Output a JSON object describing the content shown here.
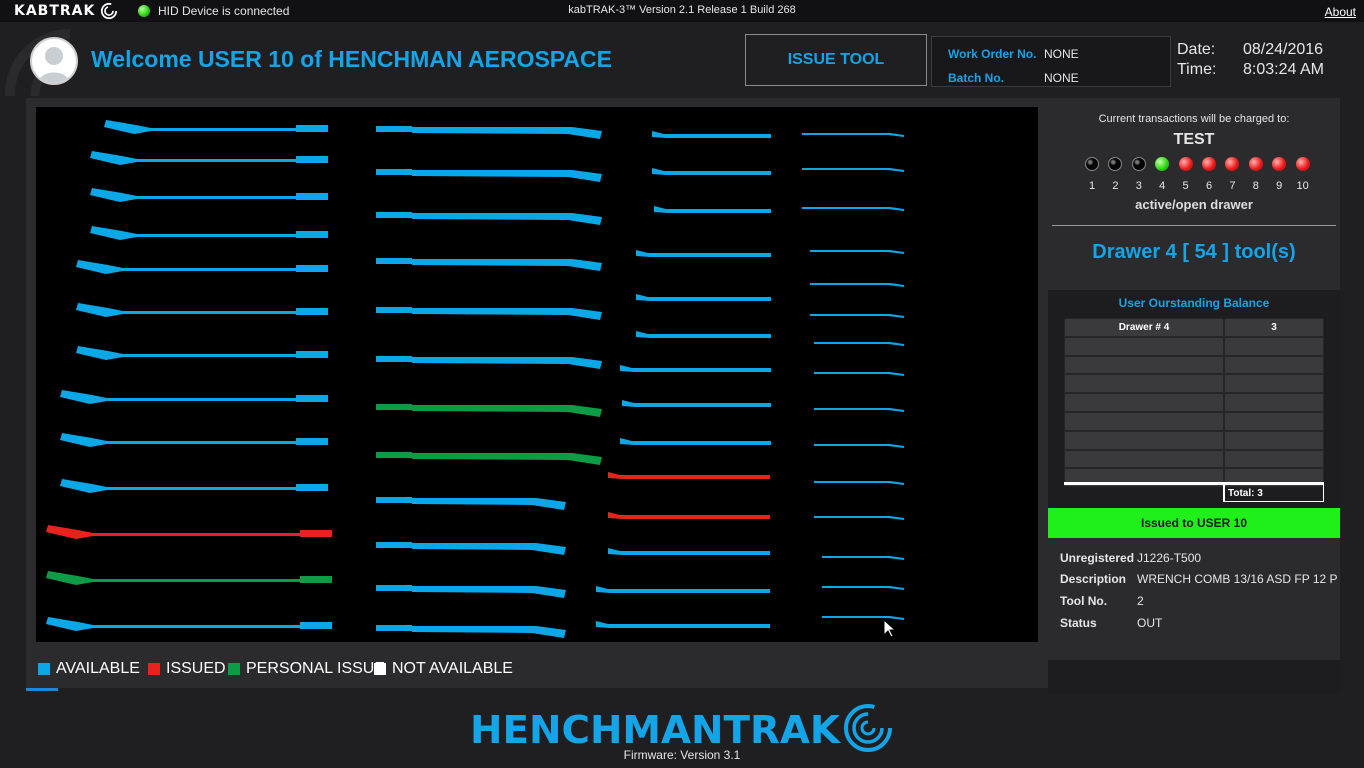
{
  "topbar": {
    "brand": "KABTRAK",
    "hid_status": "HID Device is connected",
    "app_version": "kabTRAK-3™ Version 2.1 Release 1 Build 268",
    "about": "About"
  },
  "header": {
    "welcome": "Welcome USER 10 of HENCHMAN AEROSPACE",
    "issue_button": "ISSUE TOOL",
    "work_order_label": "Work Order No.",
    "work_order_value": "NONE",
    "batch_label": "Batch No.",
    "batch_value": "NONE",
    "date_label": "Date:",
    "date_value": "08/24/2016",
    "time_label": "Time:",
    "time_value": "8:03:24 AM"
  },
  "colors": {
    "available": "#0ba7e6",
    "issued": "#e8231e",
    "personal_issue": "#0c9c45",
    "not_available": "#ffffff",
    "accent": "#14a4e8"
  },
  "legend": [
    {
      "label": "AVAILABLE",
      "color": "#0ba7e6"
    },
    {
      "label": "ISSUED",
      "color": "#e8231e"
    },
    {
      "label": "PERSONAL ISSUE",
      "color": "#0c9c45"
    },
    {
      "label": "NOT AVAILABLE",
      "color": "#ffffff"
    }
  ],
  "tools": {
    "column_1": [
      "available",
      "available",
      "available",
      "available",
      "available",
      "available",
      "available",
      "available",
      "available",
      "available",
      "issued",
      "personal_issue",
      "available"
    ],
    "column_2": [
      "available",
      "available",
      "available",
      "available",
      "available",
      "available",
      "personal_issue",
      "personal_issue",
      "available",
      "available",
      "available",
      "available"
    ],
    "column_3": [
      "available",
      "available",
      "available",
      "available",
      "available",
      "available",
      "available",
      "available",
      "available",
      "issued",
      "issued",
      "available",
      "available",
      "available"
    ],
    "column_4": [
      "available",
      "available",
      "available",
      "available",
      "available",
      "available",
      "available",
      "available",
      "available",
      "available",
      "available",
      "available",
      "available",
      "available",
      "available"
    ]
  },
  "side": {
    "charged_label": "Current  transactions will be charged to:",
    "charged_value": "TEST",
    "drawers": [
      {
        "num": "1",
        "state": "off"
      },
      {
        "num": "2",
        "state": "off"
      },
      {
        "num": "3",
        "state": "off"
      },
      {
        "num": "4",
        "state": "green"
      },
      {
        "num": "5",
        "state": "red"
      },
      {
        "num": "6",
        "state": "red"
      },
      {
        "num": "7",
        "state": "red"
      },
      {
        "num": "8",
        "state": "red"
      },
      {
        "num": "9",
        "state": "red"
      },
      {
        "num": "10",
        "state": "red"
      }
    ],
    "drawer_caption": "active/open drawer",
    "drawer_count": "Drawer 4 [ 54 ] tool(s)",
    "balance_title": "User Ourstanding Balance",
    "balance_header": [
      "Drawer # 4",
      "3"
    ],
    "balance_total": "Total:  3",
    "issued_banner": "Issued to USER 10",
    "info": {
      "unregistered_label": "Unregistered",
      "unregistered_value": "J1226-T500",
      "description_label": "Description",
      "description_value": "WRENCH COMB 13/16 ASD FP 12 P",
      "tool_no_label": "Tool No.",
      "tool_no_value": "2",
      "status_label": "Status",
      "status_value": "OUT"
    }
  },
  "footer": {
    "brand_left": "HENCHMAN",
    "brand_right": "TRAK",
    "firmware": "Firmware: Version 3.1"
  }
}
